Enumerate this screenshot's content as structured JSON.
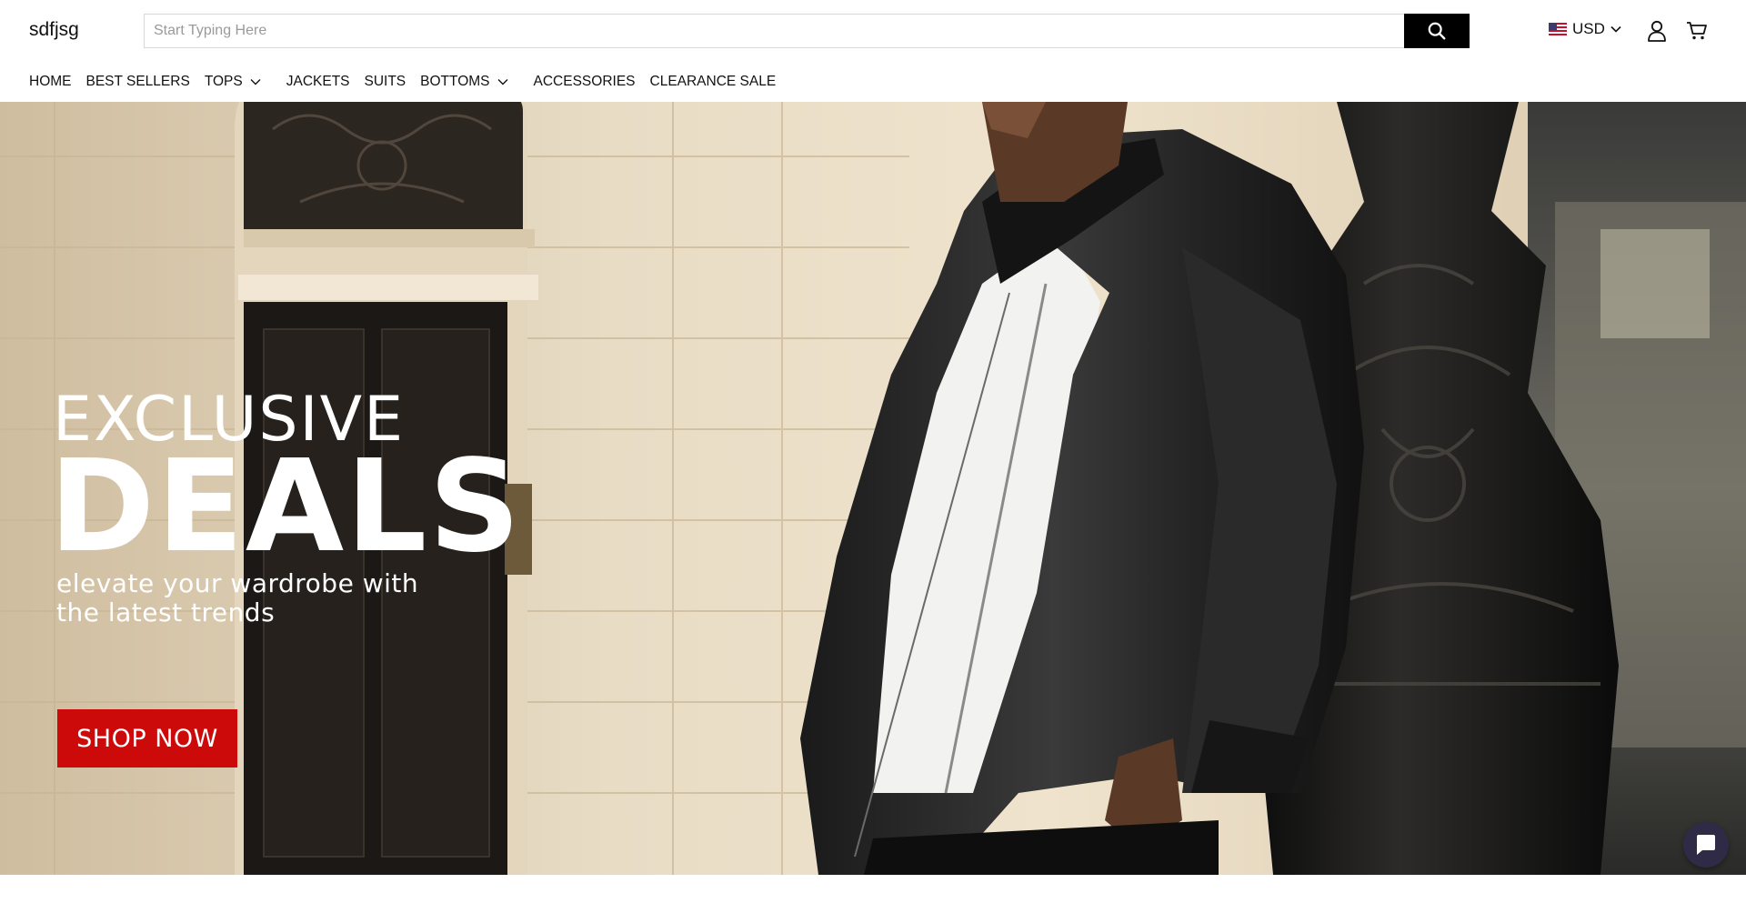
{
  "header": {
    "logo_text": "sdfjsg",
    "search": {
      "placeholder": "Start Typing Here",
      "value": ""
    },
    "search_icon": "search-icon",
    "currency": {
      "label": "USD",
      "flag_icon": "us-flag-icon",
      "chevron_icon": "chevron-down-icon"
    },
    "account_icon": "user-icon",
    "cart_icon": "cart-icon"
  },
  "nav": {
    "items": [
      {
        "label": "HOME"
      },
      {
        "label": "BEST SELLERS"
      },
      {
        "label": "TOPS",
        "dropdown": true
      },
      {
        "label": "JACKETS"
      },
      {
        "label": "SUITS"
      },
      {
        "label": "BOTTOMS",
        "dropdown": true
      },
      {
        "label": "ACCESSORIES"
      },
      {
        "label": "CLEARANCE SALE"
      }
    ]
  },
  "hero": {
    "headline_small": "EXCLUSIVE",
    "headline_big": "DEALS",
    "tagline_line1": "elevate your wardrobe with",
    "tagline_line2": "the latest trends",
    "cta_label": "SHOP NOW",
    "cta_color": "#cc0a0a",
    "image_subject": "man-in-black-leather-jacket-leaning-on-iron-lamppost-photo"
  },
  "chat": {
    "icon": "chat-bubble-icon",
    "color": "#2f2a45"
  },
  "colors": {
    "search_button": "#000000",
    "text": "#111111"
  }
}
